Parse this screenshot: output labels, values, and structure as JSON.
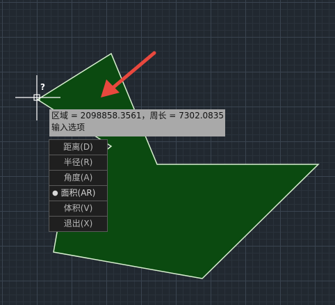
{
  "colors": {
    "background": "#212830",
    "grid_major": "#3a4450",
    "grid_minor": "#2a323b",
    "region_fill": "#0b4a10",
    "region_outline": "#d8f0d0",
    "arrow": "#e8483e",
    "crosshair": "#ffffff",
    "tooltip_bg": "#a9a9a9"
  },
  "cursor": {
    "symbol": "?"
  },
  "tooltip": {
    "line1": "区域 = 2098858.3561，周长 = 7302.0835",
    "line2": "输入选项"
  },
  "menu": {
    "items": [
      {
        "label": "距离(D)",
        "selected": false
      },
      {
        "label": "半径(R)",
        "selected": false
      },
      {
        "label": "角度(A)",
        "selected": false
      },
      {
        "label": "面积(AR)",
        "selected": true
      },
      {
        "label": "体积(V)",
        "selected": false
      },
      {
        "label": "退出(X)",
        "selected": false
      }
    ]
  }
}
